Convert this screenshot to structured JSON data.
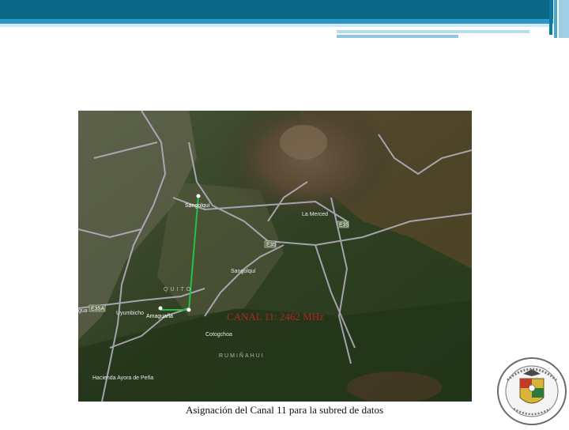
{
  "map": {
    "labels": {
      "sangolqui_point": "Sangolquí",
      "la_merced": "La Merced",
      "e35_shield": "E35",
      "e35_road": "E35",
      "sangolqui_town": "Sangolquí",
      "quito": "QUITO",
      "e35a_shield": "E35A",
      "uyumbicho": "Uyumbicho",
      "amaguana_point": "Amaguaña",
      "cotogchoa": "Cotogchoa",
      "ruminahui": "RUMIÑAHUI",
      "hacienda": "Hacienda Ayora de Peña",
      "left_edge": "gua"
    },
    "link_color": "#22c24a"
  },
  "overlay": {
    "channel_label": "CANAL 11: 2462 MHz"
  },
  "caption": "Asignación del Canal 11 para la subred de datos",
  "colors": {
    "header_dark": "#0a6986",
    "header_mid": "#2b97c4",
    "channel_text": "#b0271f"
  }
}
